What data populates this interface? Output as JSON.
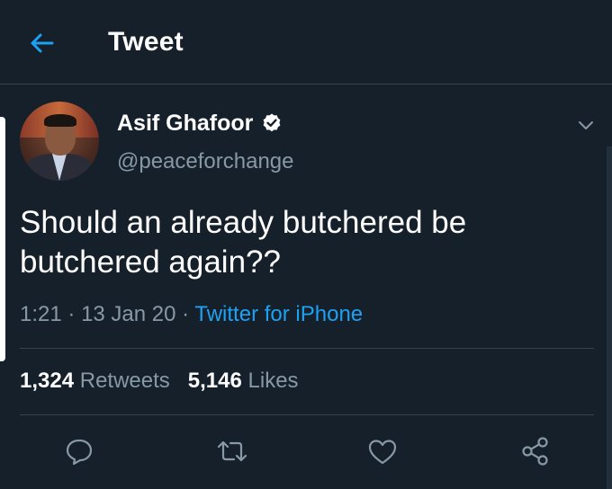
{
  "header": {
    "title": "Tweet"
  },
  "user": {
    "name": "Asif Ghafoor",
    "handle": "@peaceforchange"
  },
  "tweet": {
    "text": "Should an already butchered be butchered again??",
    "time": "1:21",
    "date": "13 Jan 20",
    "source": "Twitter for iPhone"
  },
  "stats": {
    "retweets_count": "1,324",
    "retweets_label": "Retweets",
    "likes_count": "5,146",
    "likes_label": "Likes"
  },
  "colors": {
    "background": "#15202b",
    "accent": "#1da1f2",
    "muted": "#8899a6",
    "divider": "#38444d"
  },
  "icons": {
    "back": "arrow-left-icon",
    "verified": "verified-badge-icon",
    "menu": "chevron-down-icon",
    "reply": "reply-icon",
    "retweet": "retweet-icon",
    "like": "heart-icon",
    "share": "share-icon"
  }
}
